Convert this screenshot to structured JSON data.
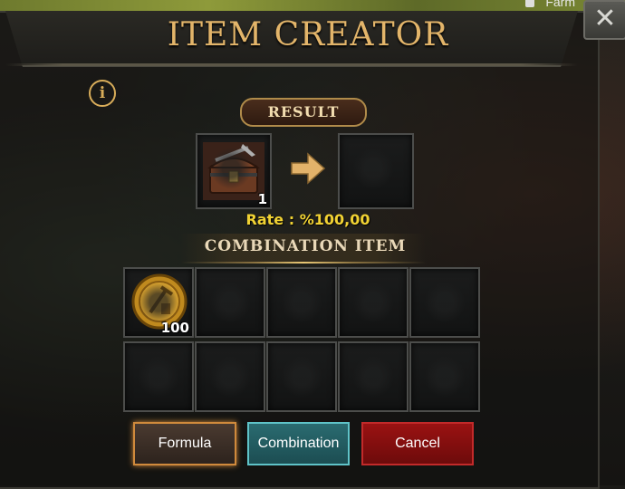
{
  "top_bar": {
    "farm_label": "Farm"
  },
  "dialog": {
    "title": "ITEM CREATOR",
    "close_label": "✕",
    "info_label": "i"
  },
  "result": {
    "label": "RESULT",
    "item_icon": "treasure-chest-icon",
    "item_count": "1",
    "arrow_icon": "arrow-right-icon",
    "rate_text": "Rate : %100,00"
  },
  "combination": {
    "label": "COMBINATION ITEM",
    "slots": [
      {
        "icon": "gold-coin-icon",
        "count": "100"
      }
    ]
  },
  "buttons": {
    "formula": "Formula",
    "combination": "Combination",
    "cancel": "Cancel"
  },
  "colors": {
    "title": "#e3b56a",
    "rate": "#f1d233",
    "formula_border": "#d08a3c",
    "combination_bg": "#2a6b70",
    "cancel_bg": "#9a1212"
  }
}
